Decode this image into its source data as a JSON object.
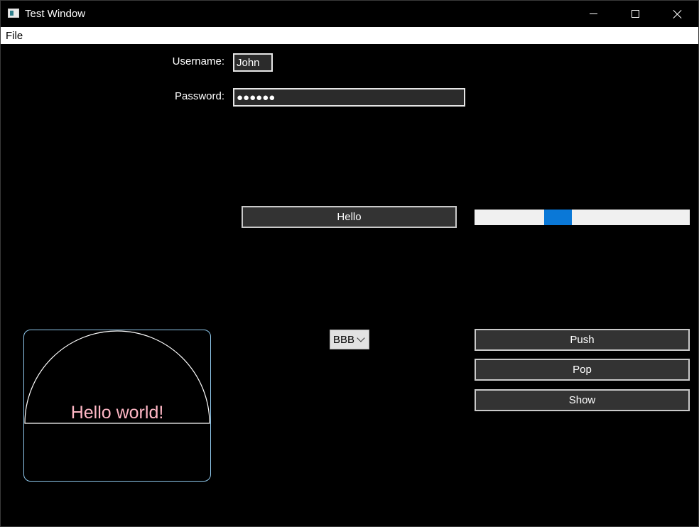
{
  "window": {
    "title": "Test Window",
    "icon": "app-window-icon"
  },
  "menubar": {
    "items": [
      "File"
    ]
  },
  "form": {
    "username_label": "Username:",
    "username_value": "John",
    "password_label": "Password:",
    "password_value": "●●●●●●"
  },
  "buttons": {
    "hello": "Hello",
    "push": "Push",
    "pop": "Pop",
    "show": "Show"
  },
  "scrollbar": {
    "position_fraction": 0.37,
    "accent": "#0a78d7"
  },
  "combo": {
    "selected": "BBB"
  },
  "canvas": {
    "text": "Hello world!",
    "text_color": "#ffb7c5",
    "border_color": "#8fc8ec"
  },
  "colors": {
    "background": "#000000",
    "button_bg": "#333333",
    "menubar_bg": "#ffffff"
  }
}
